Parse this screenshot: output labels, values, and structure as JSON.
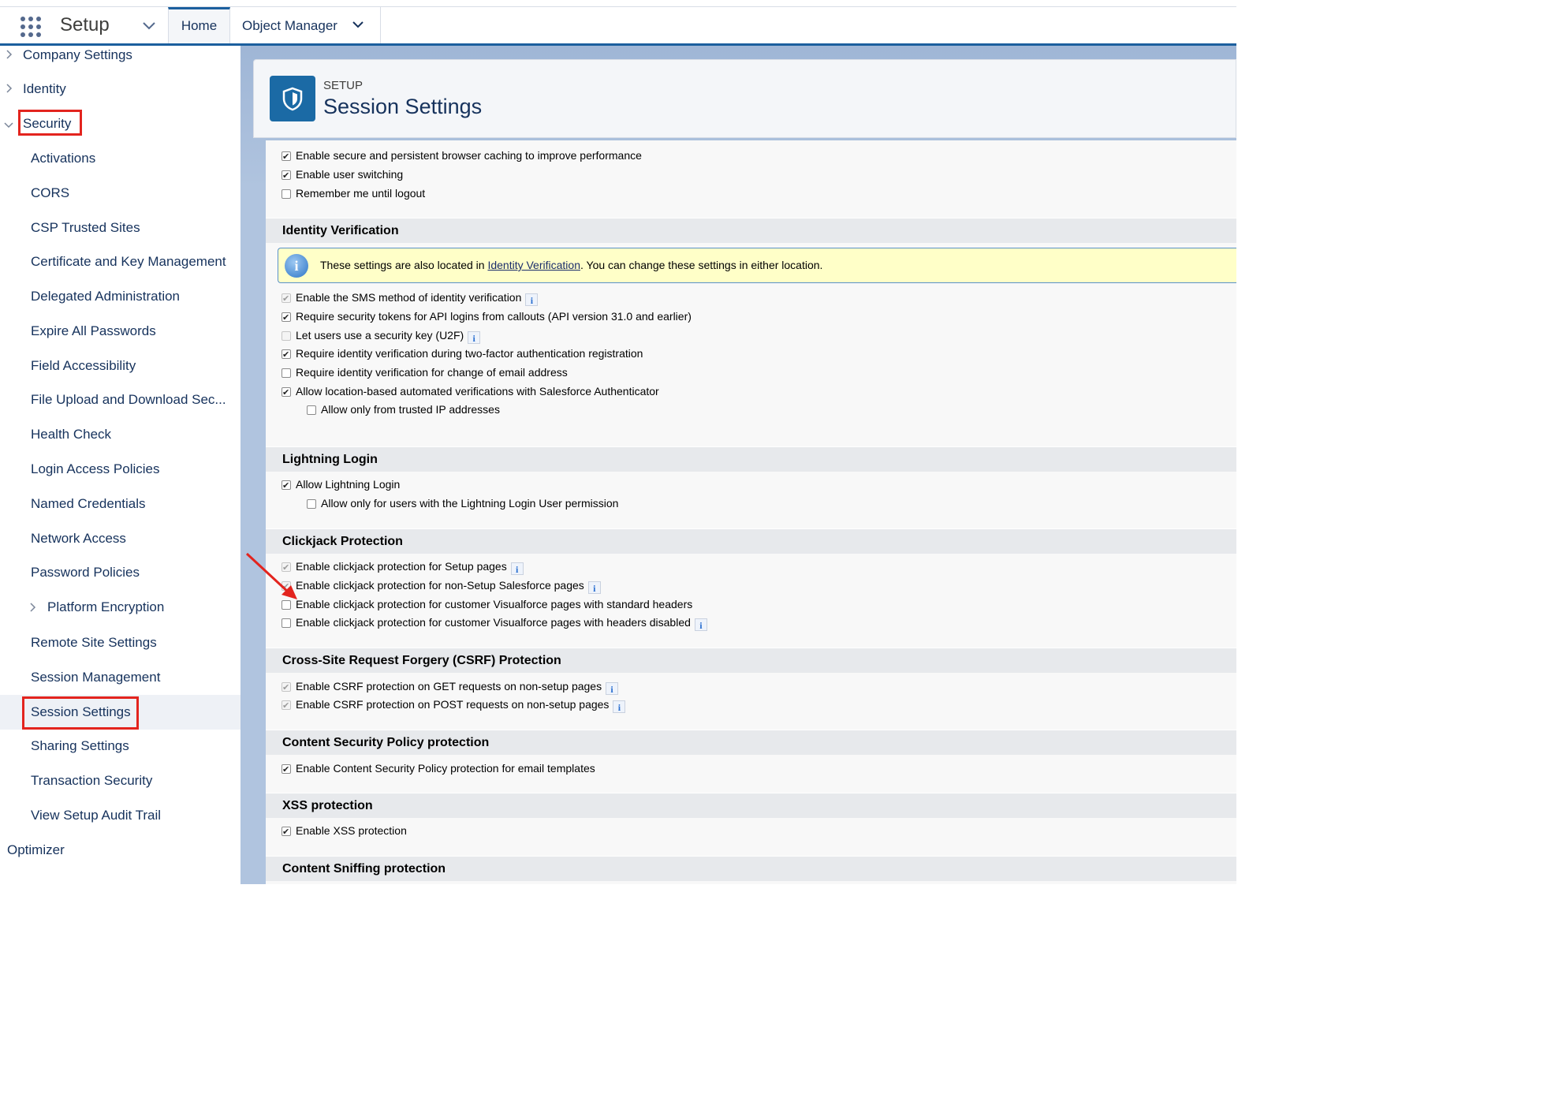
{
  "app": {
    "name": "Setup"
  },
  "tabs": {
    "home": "Home",
    "object_manager": "Object Manager"
  },
  "sidebar": {
    "company_settings": "Company Settings",
    "identity": "Identity",
    "security": "Security",
    "items": [
      "Activations",
      "CORS",
      "CSP Trusted Sites",
      "Certificate and Key Management",
      "Delegated Administration",
      "Expire All Passwords",
      "Field Accessibility",
      "File Upload and Download Sec...",
      "Health Check",
      "Login Access Policies",
      "Named Credentials",
      "Network Access",
      "Password Policies",
      "Platform Encryption",
      "Remote Site Settings",
      "Session Management",
      "Session Settings",
      "Sharing Settings",
      "Transaction Security",
      "View Setup Audit Trail"
    ],
    "optimizer": "Optimizer",
    "selected": "Session Settings"
  },
  "header": {
    "kicker": "SETUP",
    "title": "Session Settings"
  },
  "content": {
    "top_rows": [
      {
        "label": "Enable secure and persistent browser caching to improve performance",
        "checked": true
      },
      {
        "label": "Enable user switching",
        "checked": true
      },
      {
        "label": "Remember me until logout",
        "checked": false
      }
    ],
    "identity_verification": {
      "title": "Identity Verification",
      "banner_pre": "These settings are also located in ",
      "banner_link": "Identity Verification",
      "banner_post": ". You can change these settings in either location.",
      "rows": [
        {
          "label": "Enable the SMS method of identity verification",
          "checked": true,
          "disabled": true,
          "info": true
        },
        {
          "label": "Require security tokens for API logins from callouts (API version 31.0 and earlier)",
          "checked": true
        },
        {
          "label": "Let users use a security key (U2F)",
          "checked": false,
          "disabled": true,
          "info": true
        },
        {
          "label": "Require identity verification during two-factor authentication registration",
          "checked": true
        },
        {
          "label": "Require identity verification for change of email address",
          "checked": false
        },
        {
          "label": "Allow location-based automated verifications with Salesforce Authenticator",
          "checked": true
        },
        {
          "label": "Allow only from trusted IP addresses",
          "checked": false,
          "indent": true
        }
      ]
    },
    "lightning_login": {
      "title": "Lightning Login",
      "rows": [
        {
          "label": "Allow Lightning Login",
          "checked": true
        },
        {
          "label": "Allow only for users with the Lightning Login User permission",
          "checked": false,
          "indent": true
        }
      ]
    },
    "clickjack": {
      "title": "Clickjack Protection",
      "rows": [
        {
          "label": "Enable clickjack protection for Setup pages",
          "checked": true,
          "disabled": true,
          "info": true
        },
        {
          "label": "Enable clickjack protection for non-Setup Salesforce pages",
          "checked": true,
          "disabled": true,
          "info": true
        },
        {
          "label": "Enable clickjack protection for customer Visualforce pages with standard headers",
          "checked": false
        },
        {
          "label": "Enable clickjack protection for customer Visualforce pages with headers disabled",
          "checked": false,
          "info": true
        }
      ]
    },
    "csrf": {
      "title": "Cross-Site Request Forgery (CSRF) Protection",
      "rows": [
        {
          "label": "Enable CSRF protection on GET requests on non-setup pages",
          "checked": true,
          "disabled": true,
          "info": true
        },
        {
          "label": "Enable CSRF protection on POST requests on non-setup pages",
          "checked": true,
          "disabled": true,
          "info": true
        }
      ]
    },
    "csp": {
      "title": "Content Security Policy protection",
      "rows": [
        {
          "label": "Enable Content Security Policy protection for email templates",
          "checked": true
        }
      ]
    },
    "xss": {
      "title": "XSS protection",
      "rows": [
        {
          "label": "Enable XSS protection",
          "checked": true
        }
      ]
    },
    "sniffing": {
      "title": "Content Sniffing protection"
    }
  },
  "colors": {
    "brand": "#1b6aa5",
    "annotation": "#e3241e",
    "banner": "#ffffc8"
  },
  "icons": [
    "app-launcher-icon",
    "chevron-down-icon",
    "chevron-right-icon",
    "shield-icon",
    "info-icon",
    "annotation-arrow-icon"
  ]
}
